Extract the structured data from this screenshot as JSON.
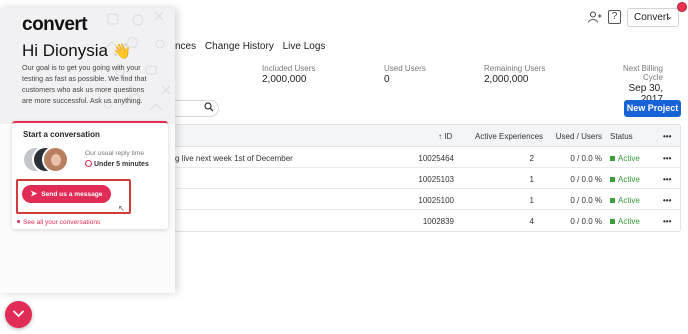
{
  "header": {
    "account_label": "Convert",
    "help_label": "?"
  },
  "tabs": [
    "nces",
    "Change History",
    "Live Logs"
  ],
  "stats": [
    {
      "label": "Included Users",
      "value": "2,000,000"
    },
    {
      "label": "Used Users",
      "value": "0"
    },
    {
      "label": "Remaining Users",
      "value": "2,000,000"
    },
    {
      "label": "Next Billing Cycle",
      "value": "Sep 30, 2017"
    }
  ],
  "toolbar": {
    "new_project_label": "New Project"
  },
  "table": {
    "headers": {
      "id": "ID",
      "experiences": "Active Experiences",
      "used": "Used / Users",
      "status": "Status",
      "actions": "•••"
    },
    "rows": [
      {
        "name": "g live next week 1st of December",
        "id": "10025464",
        "experiences": "2",
        "used": "0 / 0.0 %",
        "status": "Active",
        "actions": "•••"
      },
      {
        "name": "",
        "id": "10025103",
        "experiences": "1",
        "used": "0 / 0.0 %",
        "status": "Active",
        "actions": "•••"
      },
      {
        "name": "",
        "id": "10025100",
        "experiences": "1",
        "used": "0 / 0.0 %",
        "status": "Active",
        "actions": "•••"
      },
      {
        "name": "",
        "id": "1002839",
        "experiences": "4",
        "used": "0 / 0.0 %",
        "status": "Active",
        "actions": "•••"
      }
    ]
  },
  "widget": {
    "logo_text": "convert",
    "greeting": "Hi Dionysia",
    "wave_emoji": "👋",
    "intro": "Our goal is to get you going with your testing as fast as possible. We find that customers who ask us more questions are more successful. Ask us anything.",
    "card_title": "Start a conversation",
    "reply_label": "Our usual reply time",
    "reply_value": "Under 5 minutes",
    "send_label": "Send us a message",
    "see_all_label": "See all your conversations"
  },
  "colors": {
    "accent": "#e12d55",
    "primary": "#1862d8",
    "active": "#3ba03b"
  }
}
